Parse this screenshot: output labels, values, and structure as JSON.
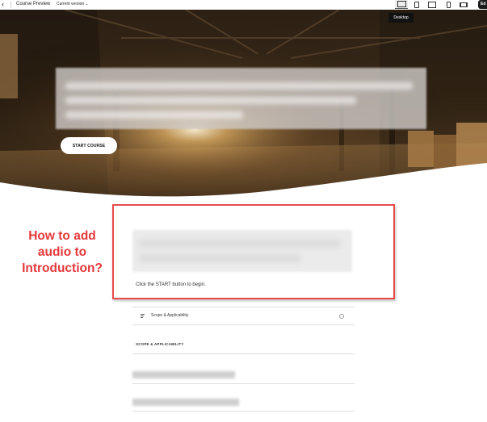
{
  "topbar": {
    "title": "Course Preview",
    "version_label": "Current version",
    "edit_label": "Ed",
    "device_tooltip": "Desktop",
    "icons": [
      "back-arrow-icon",
      "chevron-down-icon",
      "desktop-icon",
      "tablet-icon",
      "laptop-icon",
      "phone-icon",
      "widescreen-icon"
    ]
  },
  "hero": {
    "start_button": "START COURSE"
  },
  "annotation": {
    "lines": [
      "How to add",
      "audio to",
      "Introduction?"
    ],
    "color": "#e5383b"
  },
  "intro": {
    "instruction_prefix": "Click the ",
    "instruction_strong": "START",
    "instruction_suffix": " button to begin."
  },
  "lessons": {
    "items": [
      {
        "label": "Scope & Applicability",
        "icon": "list-lines-icon",
        "status_icon": "circle-status-icon"
      }
    ],
    "section_heading": "SCOPE & APPLICABILITY"
  }
}
